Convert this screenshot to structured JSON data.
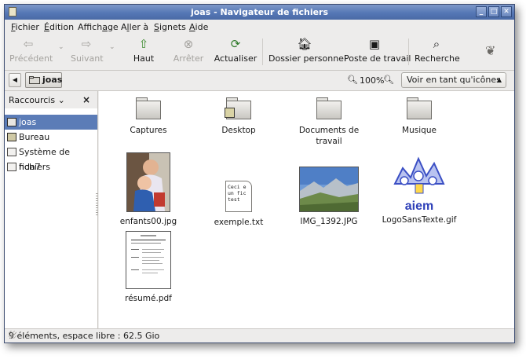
{
  "window": {
    "title": "joas - Navigateur de fichiers"
  },
  "menu": [
    {
      "label_pre": "",
      "label_key": "F",
      "label_post": "ichier"
    },
    {
      "label_pre": "",
      "label_key": "É",
      "label_post": "dition"
    },
    {
      "label_pre": "Affich",
      "label_key": "a",
      "label_post": "ge"
    },
    {
      "label_pre": "A",
      "label_key": "l",
      "label_post": "ler à"
    },
    {
      "label_pre": "",
      "label_key": "S",
      "label_post": "ignets"
    },
    {
      "label_pre": "",
      "label_key": "A",
      "label_post": "ide"
    }
  ],
  "toolbar": {
    "previous": "Précédent",
    "next": "Suivant",
    "up": "Haut",
    "stop": "Arrêter",
    "reload": "Actualiser",
    "home": "Dossier personnel",
    "computer": "Poste de travail",
    "search": "Recherche"
  },
  "location": {
    "path": "joas",
    "zoom": "100%",
    "view_mode": "Voir en tant qu'icônes"
  },
  "sidebar": {
    "title": "Raccourcis",
    "items": [
      {
        "label": "joas",
        "icon": "home-folder-icon",
        "selected": true
      },
      {
        "label": "Bureau",
        "icon": "desktop-icon",
        "selected": false
      },
      {
        "label": "Système de fichiers",
        "icon": "harddisk-icon",
        "selected": false
      },
      {
        "label": "hda7",
        "icon": "drive-icon",
        "selected": false
      }
    ]
  },
  "files": [
    {
      "name": "Captures",
      "type": "folder"
    },
    {
      "name": "Desktop",
      "type": "folder"
    },
    {
      "name": "Documents de travail",
      "type": "folder"
    },
    {
      "name": "Musique",
      "type": "folder"
    },
    {
      "name": "enfants00.jpg",
      "type": "image"
    },
    {
      "name": "exemple.txt",
      "type": "text",
      "preview": [
        "Ceci e",
        "un fic",
        "test"
      ]
    },
    {
      "name": "IMG_1392.JPG",
      "type": "image"
    },
    {
      "name": "LogoSansTexte.gif",
      "type": "image",
      "logo_text": "aiem"
    },
    {
      "name": "résumé.pdf",
      "type": "pdf"
    }
  ],
  "status": {
    "text": "9 éléments, espace libre : 62.5 Gio"
  },
  "colors": {
    "titlebar": "#5577b5",
    "selection": "#5b7cb7",
    "background": "#edeceb"
  }
}
